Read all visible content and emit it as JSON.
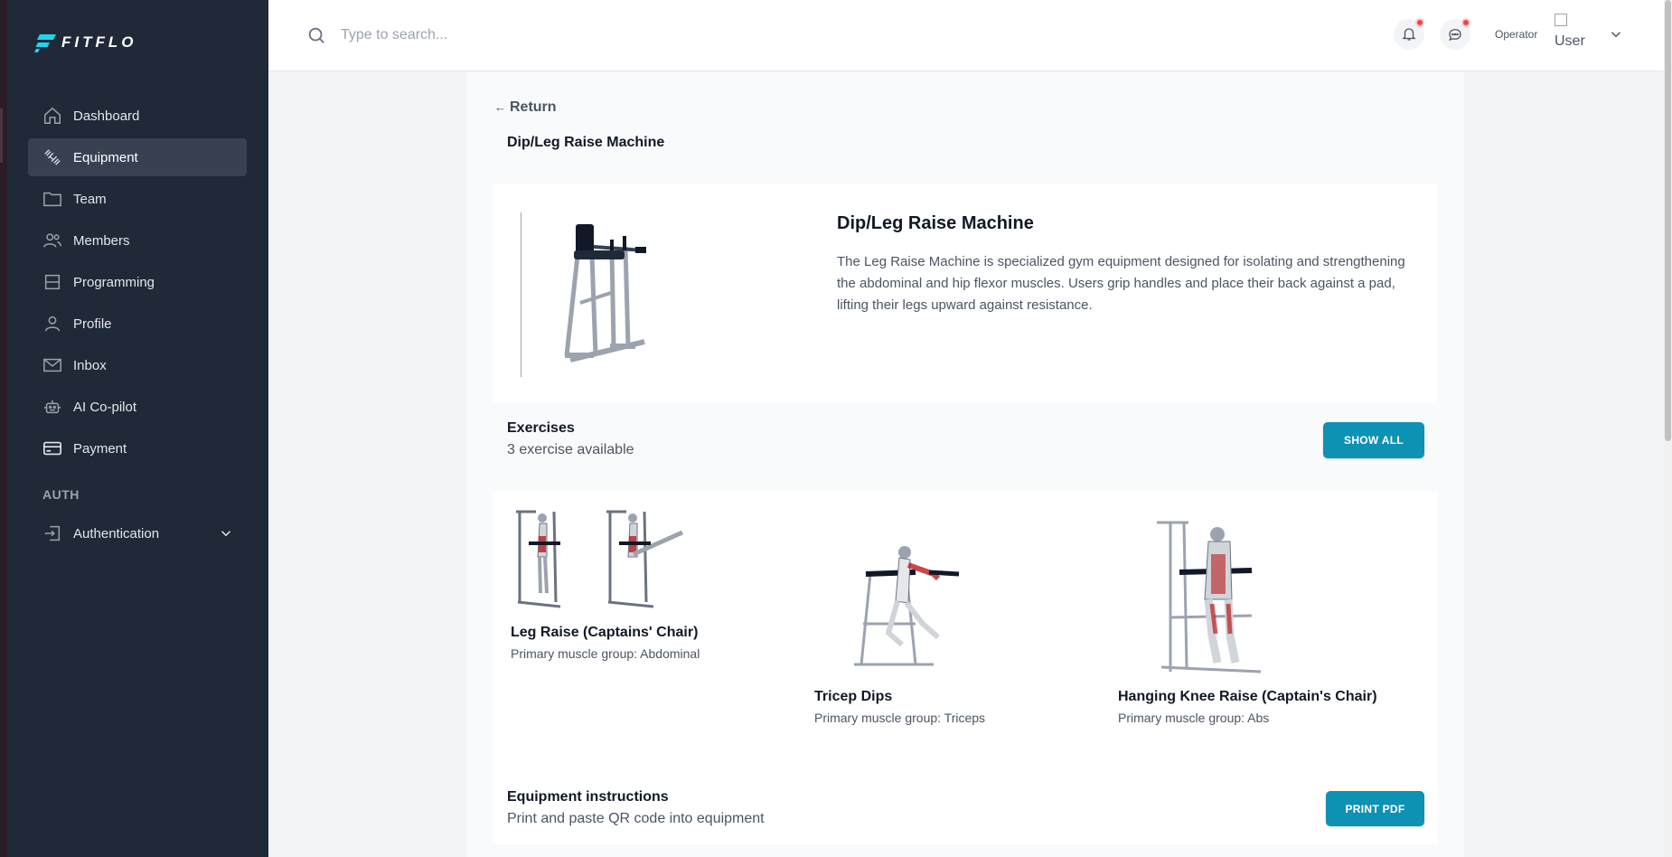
{
  "app": {
    "logo_text": "FITFLO"
  },
  "sidebar": {
    "items": [
      {
        "label": "Dashboard",
        "icon": "home-icon"
      },
      {
        "label": "Equipment",
        "icon": "dumbbell-icon",
        "active": true
      },
      {
        "label": "Team",
        "icon": "folder-icon"
      },
      {
        "label": "Members",
        "icon": "users-icon"
      },
      {
        "label": "Programming",
        "icon": "layout-icon"
      },
      {
        "label": "Profile",
        "icon": "user-icon"
      },
      {
        "label": "Inbox",
        "icon": "mail-icon"
      },
      {
        "label": "AI Co-pilot",
        "icon": "robot-icon"
      },
      {
        "label": "Payment",
        "icon": "credit-card-icon"
      }
    ],
    "section_label": "AUTH",
    "auth_item": {
      "label": "Authentication",
      "icon": "sign-in-icon"
    }
  },
  "topbar": {
    "search_placeholder": "Type to search...",
    "operator_label": "Operator",
    "user_img_alt": "User"
  },
  "page": {
    "return_label": "Return",
    "title": "Dip/Leg Raise Machine"
  },
  "equipment": {
    "name": "Dip/Leg Raise Machine",
    "description": "The Leg Raise Machine is specialized gym equipment designed for isolating and strengthening the abdominal and hip flexor muscles. Users grip handles and place their back against a pad, lifting their legs upward against resistance."
  },
  "exercises": {
    "heading": "Exercises",
    "count_text": "3 exercise available",
    "show_all_label": "SHOW ALL",
    "items": [
      {
        "name": "Leg Raise (Captains' Chair)",
        "group": "Primary muscle group: Abdominal"
      },
      {
        "name": "Tricep Dips",
        "group": "Primary muscle group: Triceps"
      },
      {
        "name": "Hanging Knee Raise (Captain's Chair)",
        "group": "Primary muscle group: Abs"
      }
    ]
  },
  "instructions": {
    "heading": "Equipment instructions",
    "sub": "Print and paste QR code into equipment",
    "print_label": "PRINT PDF"
  },
  "colors": {
    "sidebar_bg": "#1f2937",
    "accent": "#0e92b3",
    "logo_accent": "#22d3ee",
    "notification": "#ef4444"
  }
}
